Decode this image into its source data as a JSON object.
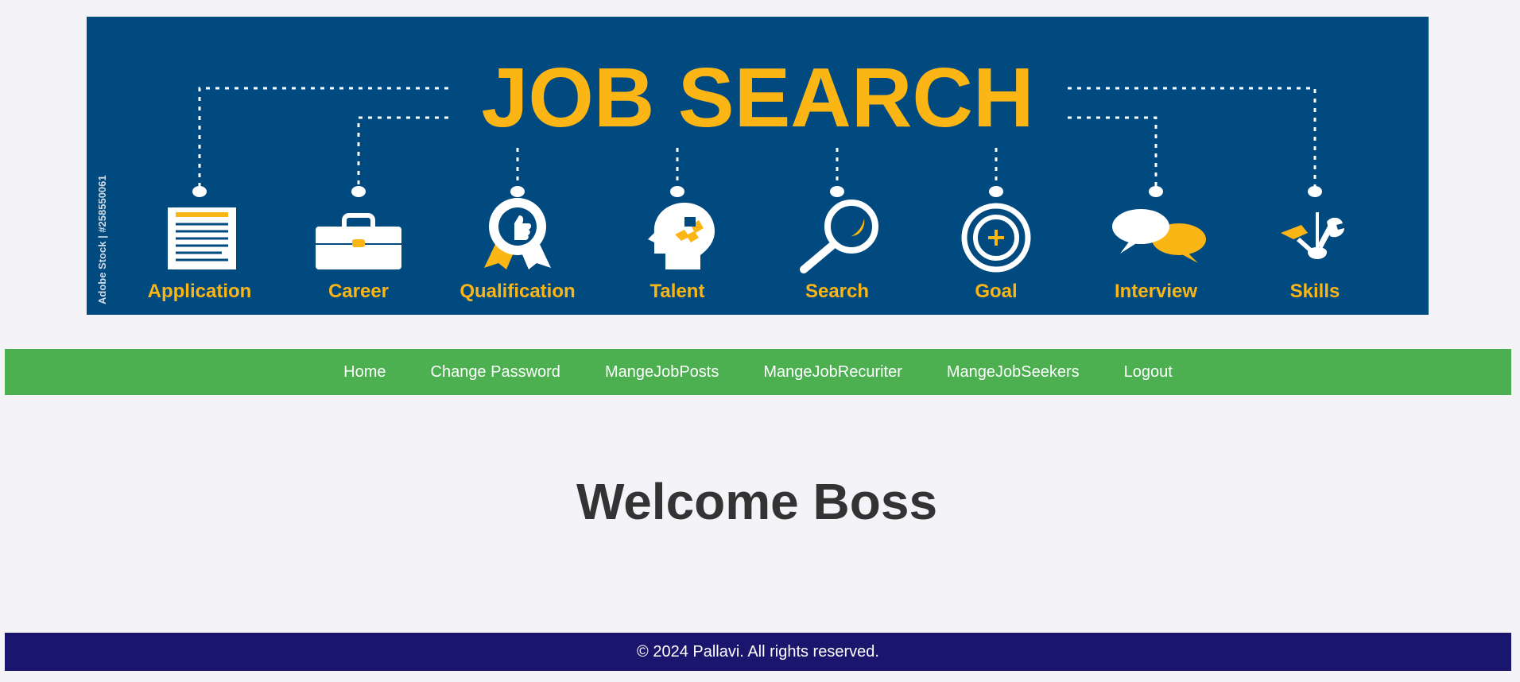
{
  "banner": {
    "title": "JOB SEARCH",
    "watermark": "Adobe Stock | #258550061",
    "items": [
      {
        "label": "Application",
        "icon": "document-icon"
      },
      {
        "label": "Career",
        "icon": "briefcase-icon"
      },
      {
        "label": "Qualification",
        "icon": "award-badge-icon"
      },
      {
        "label": "Talent",
        "icon": "head-puzzle-icon"
      },
      {
        "label": "Search",
        "icon": "magnifier-icon"
      },
      {
        "label": "Goal",
        "icon": "target-icon"
      },
      {
        "label": "Interview",
        "icon": "speech-bubbles-icon"
      },
      {
        "label": "Skills",
        "icon": "tools-icon"
      }
    ],
    "colors": {
      "background": "#014a80",
      "accent": "#fbb615",
      "icon": "#ffffff"
    }
  },
  "nav": {
    "items": [
      {
        "label": "Home"
      },
      {
        "label": "Change Password"
      },
      {
        "label": "MangeJobPosts"
      },
      {
        "label": "MangeJobRecuriter"
      },
      {
        "label": "MangeJobSeekers"
      },
      {
        "label": "Logout"
      }
    ],
    "color": "#4caf50"
  },
  "main": {
    "title": "Welcome Boss"
  },
  "footer": {
    "text": "© 2024 Pallavi. All rights reserved.",
    "color": "#1b166d"
  }
}
